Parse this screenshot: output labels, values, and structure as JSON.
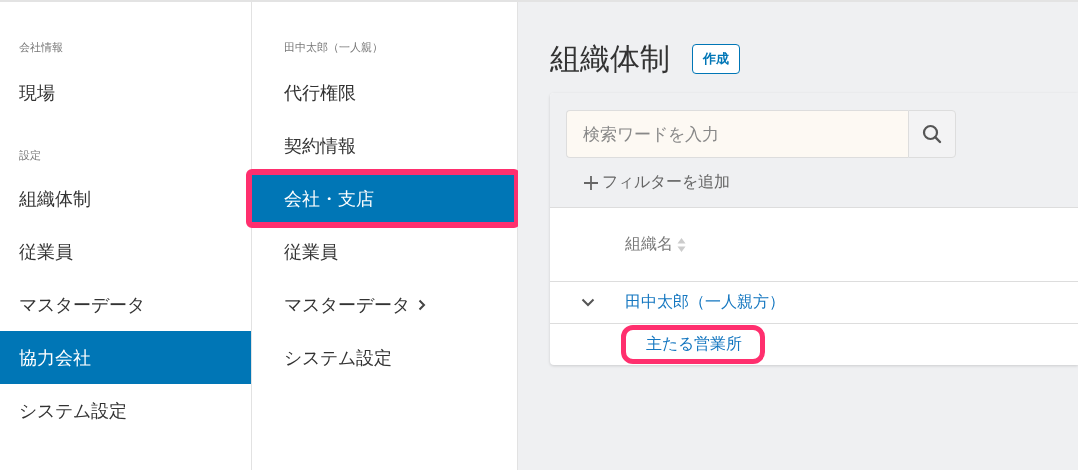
{
  "sidebar": {
    "sections": [
      {
        "heading": "会社情報",
        "items": [
          {
            "label": "現場",
            "selected": false
          }
        ]
      },
      {
        "heading": "設定",
        "items": [
          {
            "label": "組織体制",
            "selected": false
          },
          {
            "label": "従業員",
            "selected": false
          },
          {
            "label": "マスターデータ",
            "selected": false
          },
          {
            "label": "協力会社",
            "selected": true
          },
          {
            "label": "システム設定",
            "selected": false
          }
        ]
      }
    ]
  },
  "submenu": {
    "heading": "田中太郎（一人親）",
    "items": [
      {
        "label": "代行権限",
        "selected": false,
        "highlighted": false,
        "has_submenu": false
      },
      {
        "label": "契約情報",
        "selected": false,
        "highlighted": false,
        "has_submenu": false
      },
      {
        "label": "会社・支店",
        "selected": true,
        "highlighted": true,
        "has_submenu": false
      },
      {
        "label": "従業員",
        "selected": false,
        "highlighted": false,
        "has_submenu": false
      },
      {
        "label": "マスターデータ",
        "selected": false,
        "highlighted": false,
        "has_submenu": true
      },
      {
        "label": "システム設定",
        "selected": false,
        "highlighted": false,
        "has_submenu": false
      }
    ]
  },
  "main": {
    "title": "組織体制",
    "create_button": "作成",
    "search": {
      "placeholder": "検索ワードを入力"
    },
    "add_filter": "フィルターを追加",
    "table": {
      "columns": [
        {
          "label": "組織名",
          "sortable": true
        }
      ],
      "rows": [
        {
          "name": "田中太郎（一人親方）",
          "expanded": true,
          "highlighted": false,
          "children": [
            {
              "name": "主たる営業所",
              "highlighted": true
            }
          ]
        }
      ]
    }
  }
}
